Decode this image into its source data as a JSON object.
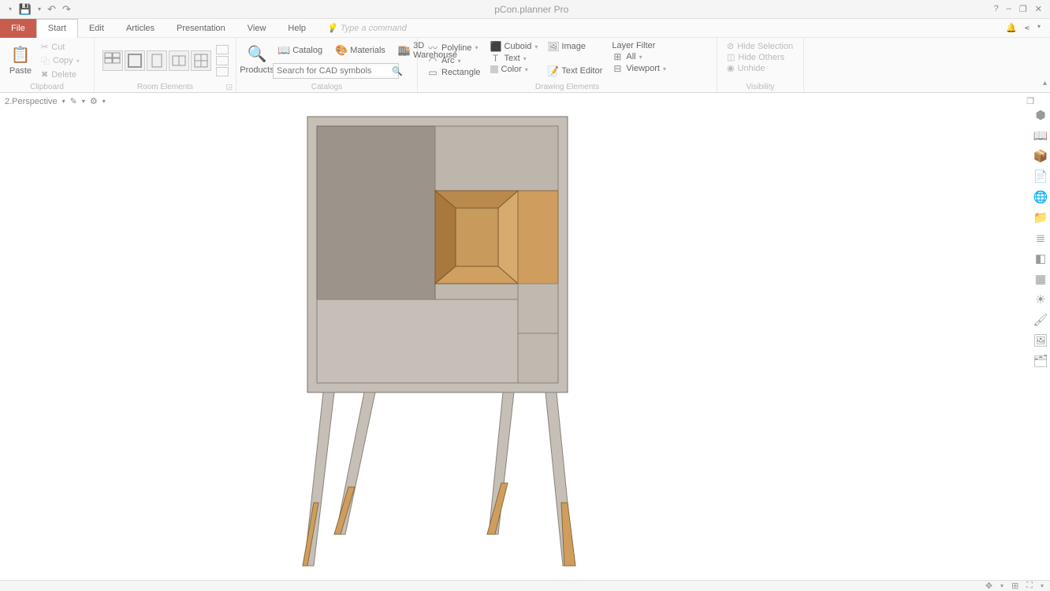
{
  "titlebar": {
    "title": "pCon.planner Pro"
  },
  "menu": {
    "file": "File",
    "tabs": [
      "Start",
      "Edit",
      "Articles",
      "Presentation",
      "View",
      "Help"
    ],
    "command_hint": "Type a command"
  },
  "ribbon": {
    "clipboard": {
      "label": "Clipboard",
      "paste": "Paste",
      "cut": "Cut",
      "copy": "Copy",
      "delete": "Delete"
    },
    "room": {
      "label": "Room Elements"
    },
    "catalogs": {
      "label": "Catalogs",
      "products": "Products",
      "catalog": "Catalog",
      "materials": "Materials",
      "warehouse": "3D Warehouse",
      "search_placeholder": "Search for CAD symbols"
    },
    "drawing": {
      "label": "Drawing Elements",
      "polyline": "Polyline",
      "arc": "Arc",
      "rectangle": "Rectangle",
      "cuboid": "Cuboid",
      "text": "Text",
      "color": "Color",
      "image": "Image",
      "text_editor": "Text Editor",
      "layer_filter": "Layer Filter",
      "all": "All",
      "viewport": "Viewport"
    },
    "visibility": {
      "label": "Visibility",
      "hide_selection": "Hide Selection",
      "hide_others": "Hide Others",
      "unhide": "Unhide"
    }
  },
  "workspace": {
    "view_label": "2.Perspective"
  }
}
